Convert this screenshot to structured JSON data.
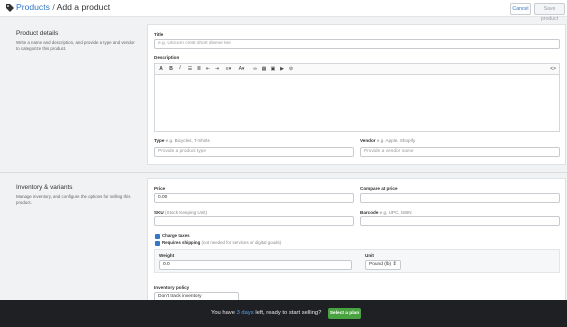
{
  "header": {
    "breadcrumb_parent": "Products",
    "breadcrumb_separator": "/",
    "page_title": "Add a product",
    "cancel_label": "Cancel",
    "save_label": "Save product"
  },
  "product_details": {
    "section_title": "Product details",
    "section_description": "Write a name and description, and provide a type and vendor to categorize this product.",
    "title_label": "Title",
    "title_placeholder": "e.g. Unicorn crest short sleeve tee",
    "description_label": "Description",
    "toolbar_icons": [
      "font-icon",
      "bold-icon",
      "italic-icon",
      "bullet-list-icon",
      "numbered-list-icon",
      "outdent-icon",
      "indent-icon",
      "align-icon",
      "text-color-icon",
      "link-icon",
      "table-icon",
      "image-icon",
      "video-icon",
      "clear-format-icon",
      "html-source-icon"
    ],
    "type_label": "Type",
    "type_hint": "e.g. Bicycles, T-Shirts",
    "type_placeholder": "Provide a product type",
    "vendor_label": "Vendor",
    "vendor_hint": "e.g. Apple, Shopify",
    "vendor_placeholder": "Provide a vendor name"
  },
  "inventory": {
    "section_title": "Inventory & variants",
    "section_description": "Manage inventory, and configure the options for selling this product.",
    "price_label": "Price",
    "price_value": "0.00",
    "compare_label": "Compare at price",
    "sku_label": "SKU",
    "sku_hint": "(Stock Keeping Unit)",
    "barcode_label": "Barcode",
    "barcode_hint": "e.g. UPC, ISBN",
    "charge_taxes_label": "Charge taxes",
    "requires_shipping_label": "Requires shipping",
    "requires_shipping_hint": "(not needed for services or digital goods)",
    "weight_label": "Weight",
    "weight_value": "0.0",
    "unit_label": "Unit",
    "unit_value": "Pound (lb)",
    "inventory_policy_label": "Inventory policy",
    "inventory_policy_value": "Don't track inventory"
  },
  "banner": {
    "text_before": "You have",
    "days_link": "3 days",
    "text_after": "left, ready to start selling?",
    "button_label": "Select a plan"
  },
  "colors": {
    "accent": "#3478c6",
    "banner_bg": "#1e2024",
    "plan_button": "#4aa341"
  }
}
